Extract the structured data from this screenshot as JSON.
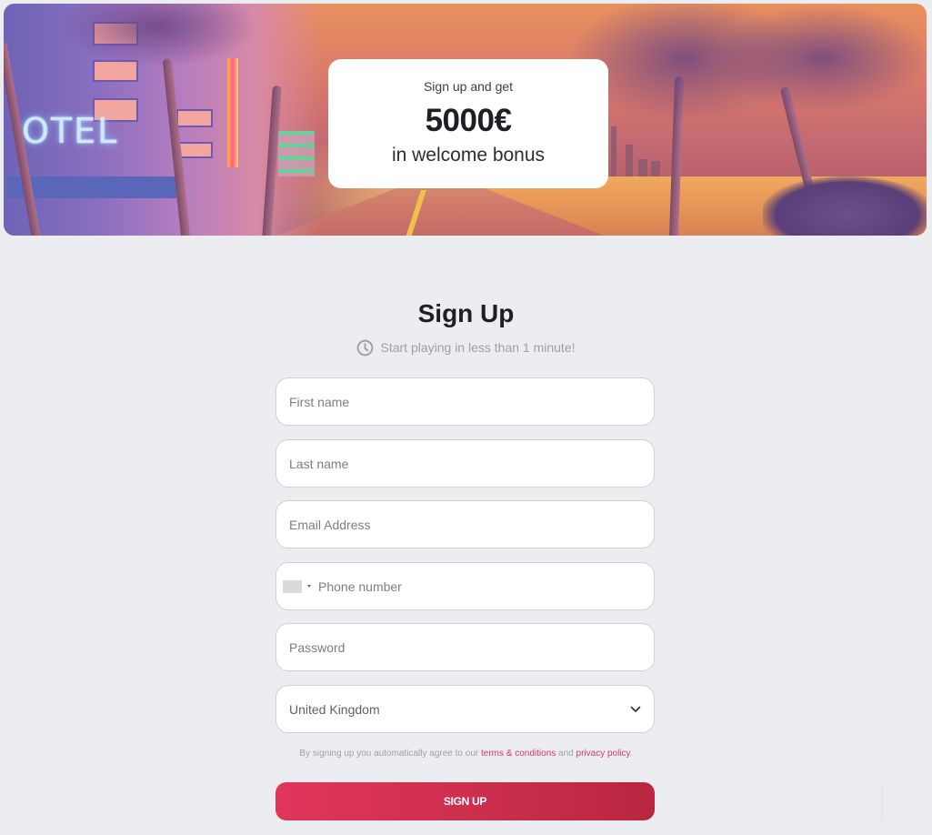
{
  "banner": {
    "promo": {
      "pre_text": "Sign up and get",
      "amount": "5000€",
      "post_text": "in welcome bonus"
    },
    "scene_sign_text": "OTEL"
  },
  "form": {
    "title": "Sign Up",
    "subtitle": "Start playing in less than 1 minute!",
    "subtitle_icon": "clock-icon",
    "fields": {
      "first_name": {
        "placeholder": "First name",
        "value": ""
      },
      "last_name": {
        "placeholder": "Last name",
        "value": ""
      },
      "email": {
        "placeholder": "Email Address",
        "value": ""
      },
      "phone": {
        "placeholder": "Phone number",
        "value": "",
        "country_flag_icon": "flag-placeholder-icon"
      },
      "password": {
        "placeholder": "Password",
        "value": ""
      },
      "country": {
        "value": "United Kingdom",
        "icon": "chevron-down-icon"
      }
    },
    "terms": {
      "prefix": "By signing up you automatically agree to our",
      "terms_link": "terms & conditions",
      "middle": "and",
      "privacy_link": "privacy policy",
      "suffix": "."
    },
    "submit_label": "SIGN UP"
  },
  "colors": {
    "background": "#ecedf1",
    "accent": "#d0304f",
    "link": "#d13a5c",
    "text_dark": "#1e1f24",
    "text_muted": "#9ea0a8"
  }
}
